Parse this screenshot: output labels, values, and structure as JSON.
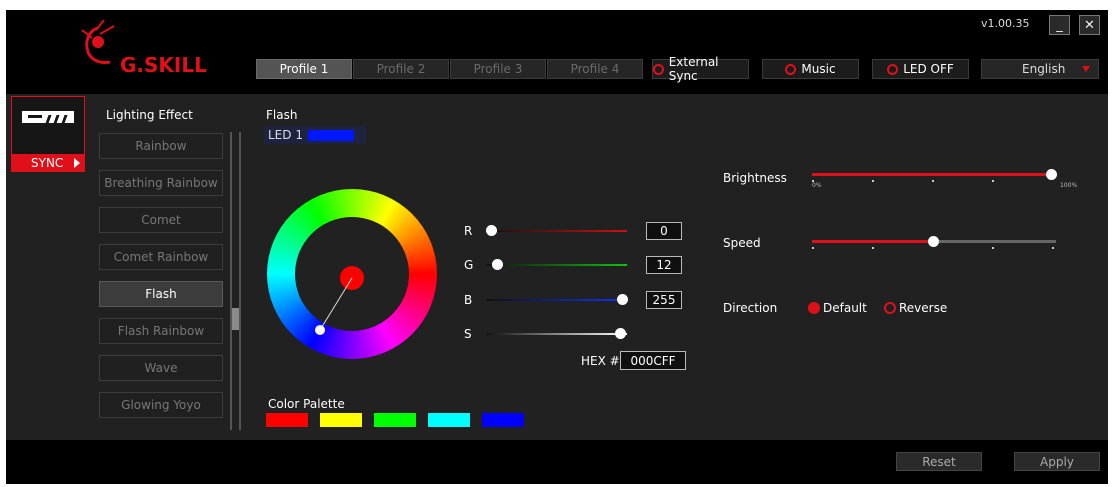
{
  "app": {
    "version": "v1.00.35",
    "logo_text": "G.SKILL",
    "minimize_label": "_",
    "close_label": "✕"
  },
  "toolbar": {
    "profiles": [
      {
        "label": "Profile 1",
        "active": true
      },
      {
        "label": "Profile 2",
        "active": false
      },
      {
        "label": "Profile 3",
        "active": false
      },
      {
        "label": "Profile 4",
        "active": false
      }
    ],
    "external_sync_label": "External Sync",
    "music_label": "Music",
    "led_off_label": "LED OFF",
    "language": "English"
  },
  "sync": {
    "label": "SYNC"
  },
  "lighting": {
    "title": "Lighting Effect",
    "effects": [
      "Rainbow",
      "Breathing Rainbow",
      "Comet",
      "Comet Rainbow",
      "Flash",
      "Flash Rainbow",
      "Wave",
      "Glowing Yoyo"
    ],
    "selected": "Flash"
  },
  "flash": {
    "title": "Flash",
    "led_label": "LED 1",
    "led_color": "#000CFF"
  },
  "rgb": {
    "r_label": "R",
    "r_value": "0",
    "g_label": "G",
    "g_value": "12",
    "b_label": "B",
    "b_value": "255",
    "s_label": "S",
    "saturation_percent": 100,
    "hex_label": "HEX #",
    "hex_value": "000CFF"
  },
  "palette": {
    "title": "Color Palette",
    "colors": [
      "#ff0000",
      "#ffff00",
      "#00ff00",
      "#00ffff",
      "#0000ff"
    ]
  },
  "controls": {
    "brightness_label": "Brightness",
    "brightness_percent": 100,
    "brightness_min_label": "0%",
    "brightness_max_label": "100%",
    "speed_label": "Speed",
    "speed_level": 3,
    "speed_levels": 5,
    "direction_label": "Direction",
    "direction_default_label": "Default",
    "direction_reverse_label": "Reverse",
    "direction_selected": "Default"
  },
  "footer": {
    "reset_label": "Reset",
    "apply_label": "Apply"
  },
  "colors": {
    "accent": "#e0101a",
    "background": "#212121"
  }
}
